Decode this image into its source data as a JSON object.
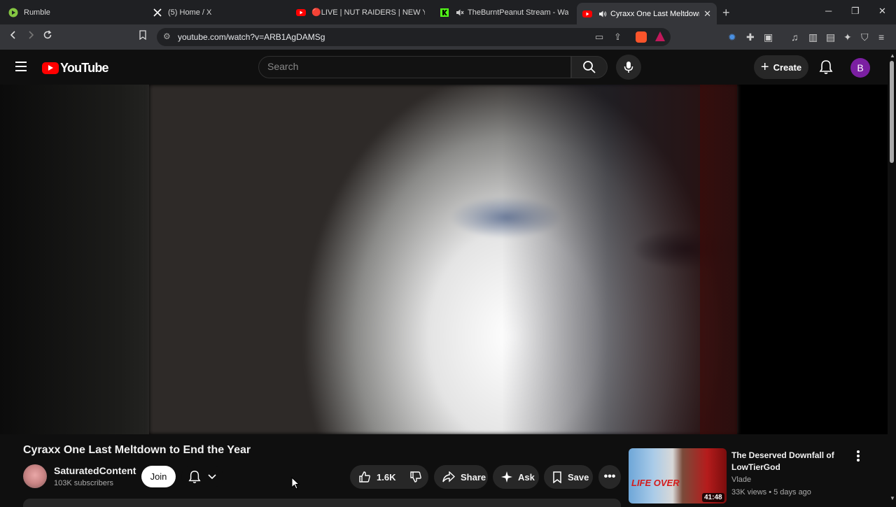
{
  "browser": {
    "tabs": [
      {
        "title": "Rumble",
        "icon": "rumble-icon",
        "active": false
      },
      {
        "title": "(5) Home / X",
        "icon": "x-icon",
        "active": false
      },
      {
        "title": "🔴LIVE | NUT RAIDERS | NEW YEAR R",
        "icon": "youtube-icon",
        "active": false
      },
      {
        "title": "TheBurntPeanut Stream - Watch L",
        "icon": "kick-icon",
        "active": false
      },
      {
        "title": "Cyraxx One Last Meltdown to",
        "icon": "youtube-icon",
        "active": true
      }
    ],
    "url": "youtube.com/watch?v=ARB1AgDAMSg",
    "colors": {
      "tabstrip": "#1f2023",
      "toolbar": "#35363a",
      "brave_orange": "#fb542b"
    }
  },
  "header": {
    "logo_text": "YouTube",
    "search_placeholder": "Search",
    "create_label": "Create",
    "avatar_letter": "B",
    "colors": {
      "youtube_red": "#ff0000",
      "avatar_bg": "#7b1fa2"
    }
  },
  "video": {
    "title": "Cyraxx One Last Meltdown to End the Year",
    "channel": {
      "name": "SaturatedContent",
      "subscribers": "103K subscribers"
    },
    "join_label": "Join",
    "likes": "1.6K",
    "share_label": "Share",
    "ask_label": "Ask",
    "save_label": "Save"
  },
  "recommendation": {
    "title": "The Deserved Downfall of LowTierGod",
    "channel": "Vlade",
    "meta": "33K views • 5 days ago",
    "duration": "41:48",
    "thumb_text": "LIFE OVER"
  }
}
